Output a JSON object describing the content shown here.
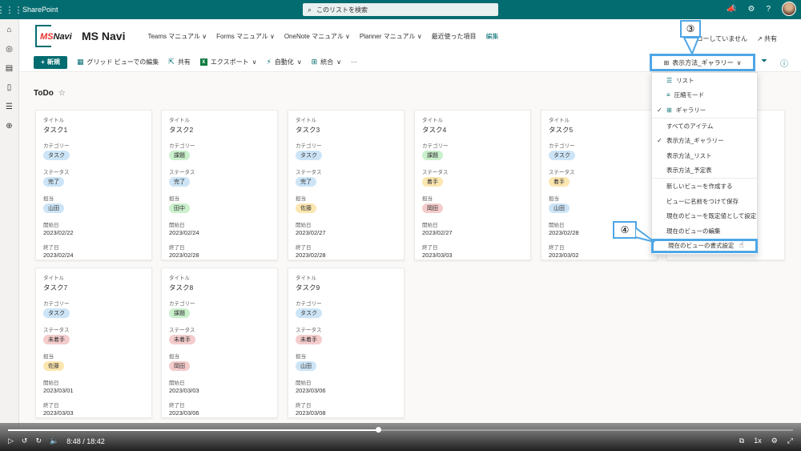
{
  "suite": {
    "brand": "SharePoint",
    "search_placeholder": "このリストを検索"
  },
  "site": {
    "logo_text_ms": "MS",
    "logo_text_navi": "Navi",
    "name": "MS Navi",
    "nav": [
      "Teams マニュアル ∨",
      "Forms マニュアル ∨",
      "OneNote マニュアル ∨",
      "Planner マニュアル ∨",
      "最近使った項目",
      "編集"
    ],
    "following": "フォローしていません",
    "share": "共有"
  },
  "commands": {
    "new": "新規",
    "grid": "グリッド ビューでの編集",
    "share": "共有",
    "export": "エクスポート",
    "automate": "自動化",
    "integrate": "統合",
    "more": "···",
    "view_selector": "表示方法_ギャラリー"
  },
  "list": {
    "title": "ToDo"
  },
  "labels": {
    "title": "タイトル",
    "category": "カテゴリー",
    "status": "ステータス",
    "assignee": "担当",
    "start": "開始日",
    "end": "終了日"
  },
  "cards": [
    {
      "title": "タスク1",
      "category": "タスク",
      "status": "完了",
      "assignee": "山田",
      "start": "2023/02/22",
      "end": "2023/02/24"
    },
    {
      "title": "タスク2",
      "category": "課題",
      "status": "完了",
      "assignee": "田中",
      "start": "2023/02/24",
      "end": "2023/02/28"
    },
    {
      "title": "タスク3",
      "category": "タスク",
      "status": "完了",
      "assignee": "佐藤",
      "start": "2023/02/27",
      "end": "2023/02/28"
    },
    {
      "title": "タスク4",
      "category": "課題",
      "status": "着手",
      "assignee": "岡田",
      "start": "2023/02/27",
      "end": "2023/03/03"
    },
    {
      "title": "タスク5",
      "category": "タスク",
      "status": "着手",
      "assignee": "山田",
      "start": "2023/02/28",
      "end": "2023/03/02"
    },
    {
      "title": "タスク7",
      "category": "タスク",
      "status": "未着手",
      "assignee": "佐藤",
      "start": "2023/03/01",
      "end": "2023/03/03"
    },
    {
      "title": "タスク8",
      "category": "課題",
      "status": "未着手",
      "assignee": "岡田",
      "start": "2023/03/03",
      "end": "2023/03/06"
    },
    {
      "title": "タスク9",
      "category": "タスク",
      "status": "未着手",
      "assignee": "山田",
      "start": "2023/03/06",
      "end": "2023/03/08"
    }
  ],
  "menu": {
    "layouts": [
      "リスト",
      "圧縮モード",
      "ギャラリー"
    ],
    "views": [
      "すべてのアイテム",
      "表示方法_ギャラリー",
      "表示方法_リスト",
      "表示方法_予定表"
    ],
    "actions": [
      "新しいビューを作成する",
      "ビューに名前をつけて保存",
      "現在のビューを既定値として設定",
      "現在のビューの編集",
      "現在のビューの書式設定"
    ]
  },
  "callouts": {
    "three": "③",
    "four": "④"
  },
  "video": {
    "time": "8:48 / 18:42",
    "speed": "1x",
    "progress": 0.471
  }
}
